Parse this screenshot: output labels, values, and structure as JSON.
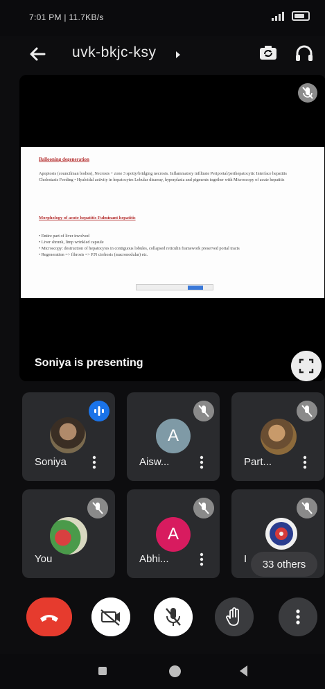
{
  "status_bar": {
    "time_text": "7:01 PM | 11.7KB/s"
  },
  "app_bar": {
    "meeting_code": "uvk-bkjc-ksy"
  },
  "presentation": {
    "presenter_label": "Soniya is presenting",
    "slide": {
      "heading": "Ballooning degeneration",
      "paragraph": "Apoptosis (councilman bodies), Necrosis + zone 3 spotty/bridging necrosis. Inflammatory infiltrate Periportal/perihepatocytic Interface hepatitis Cholestasis Feeding • Hyaloidal activity in hepatocytes Lobular disarray, hyperplasia and pigments together with Microscopy of acute hepatitis",
      "heading2": "Morphology of acute hepatitis Fulminant hepatitis",
      "bullets": [
        "• Entire part of liver involved",
        "• Liver shrunk, limp wrinkled capsule",
        "• Microscopy: destruction of hepatocytes in contiguous lobules, collapsed reticulin framework preserved portal tracts",
        "• Regeneration => fibrosis => P.N cirrhosis (macronodular) etc."
      ]
    }
  },
  "participants": [
    {
      "name": "Soniya",
      "state": "speaking",
      "avatar": "photo",
      "avatar_color": "#6b5a3e"
    },
    {
      "name": "Aisw...",
      "state": "muted",
      "avatar": "letter",
      "letter": "A",
      "avatar_color": "#7f9aa6"
    },
    {
      "name": "Part...",
      "state": "muted",
      "avatar": "photo",
      "avatar_color": "#8c6a3b"
    },
    {
      "name": "You",
      "state": "muted",
      "avatar": "photo",
      "avatar_color": "#c84a4a"
    },
    {
      "name": "Abhi...",
      "state": "muted",
      "avatar": "letter",
      "letter": "A",
      "avatar_color": "#d81b5f"
    },
    {
      "name": "I",
      "state": "muted",
      "avatar": "logo",
      "avatar_color": "#2a3d8f"
    }
  ],
  "others_label": "33 others",
  "colors": {
    "end_call": "#e63b2e",
    "speaking": "#1a73e8",
    "tile_bg": "#2a2b2e"
  },
  "icons": {
    "back": "arrow-left-icon",
    "switch_camera": "switch-camera-icon",
    "audio_output": "headphones-icon",
    "fullscreen": "fullscreen-icon",
    "end_call": "phone-hangup-icon",
    "camera": "camera-off-icon",
    "mic": "mic-off-icon",
    "raise_hand": "hand-icon",
    "more": "more-vert-icon"
  }
}
